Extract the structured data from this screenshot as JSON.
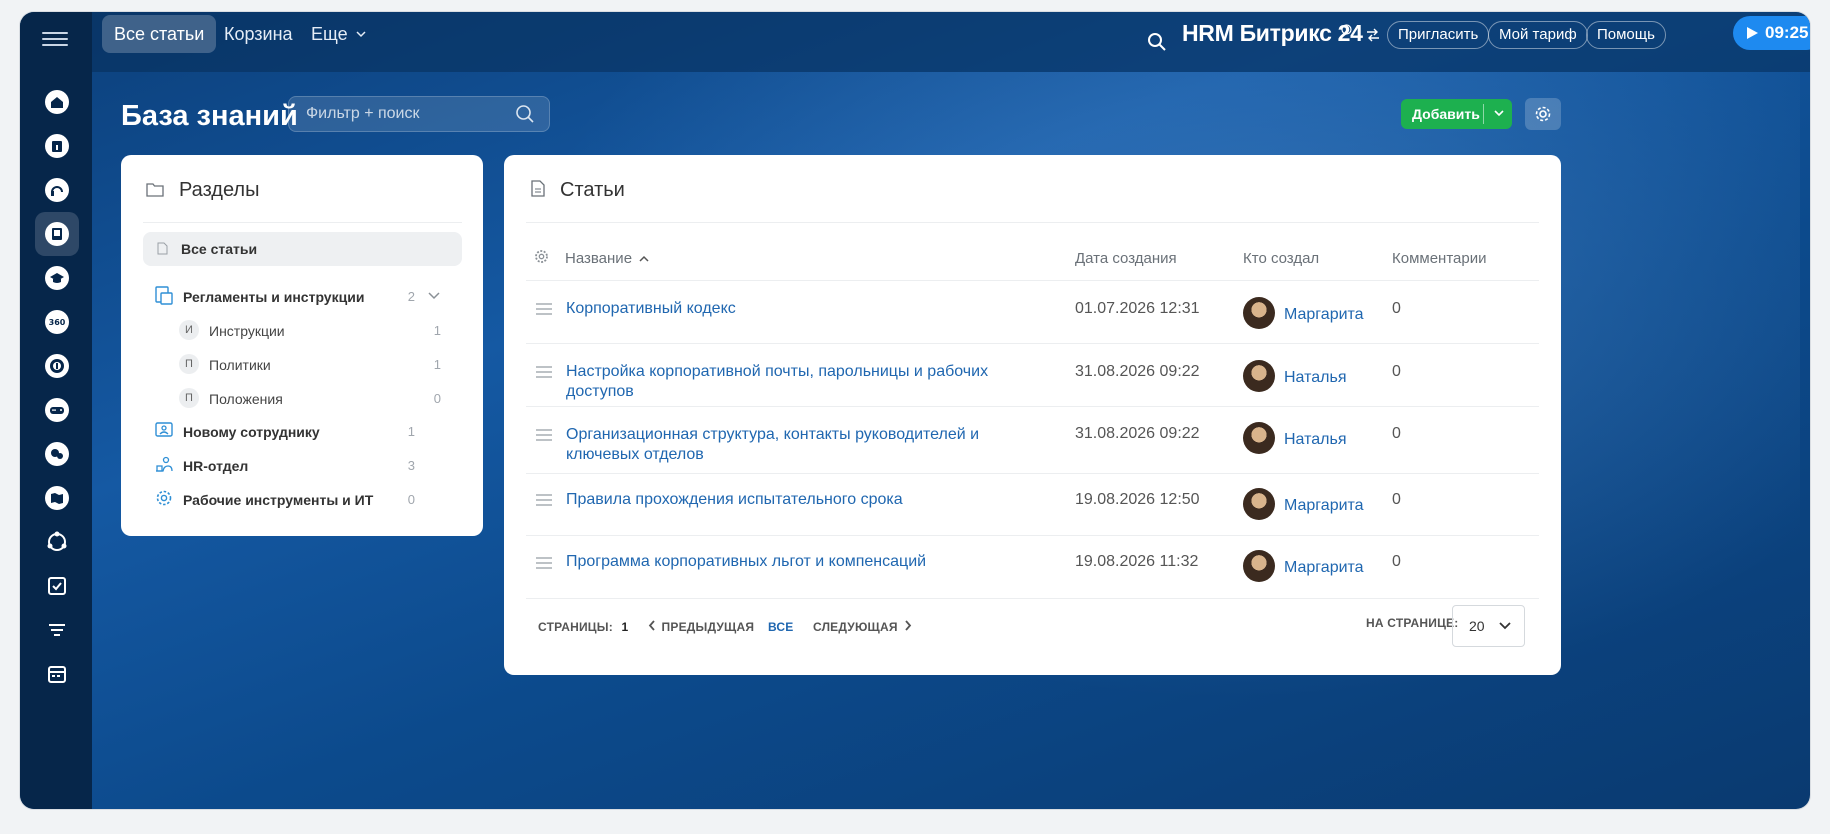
{
  "topbar": {
    "tabs": [
      {
        "label": "Все статьи",
        "active": true
      },
      {
        "label": "Корзина",
        "active": false
      },
      {
        "label": "Еще",
        "active": false
      }
    ],
    "brand": "HRM Битрикс 24",
    "invite_label": "Пригласить",
    "tariff_label": "Мой тариф",
    "help_label": "Помощь",
    "timer": "09:25"
  },
  "page": {
    "title": "База знаний",
    "filter_placeholder": "Фильтр + поиск",
    "add_label": "Добавить"
  },
  "sections": {
    "header": "Разделы",
    "all_articles": "Все статьи",
    "items": [
      {
        "label": "Регламенты и инструкции",
        "count": "2",
        "expanded": true,
        "children": [
          {
            "badge": "И",
            "label": "Инструкции",
            "count": "1"
          },
          {
            "badge": "П",
            "label": "Политики",
            "count": "1"
          },
          {
            "badge": "П",
            "label": "Положения",
            "count": "0"
          }
        ]
      },
      {
        "label": "Новому сотруднику",
        "count": "1"
      },
      {
        "label": "HR-отдел",
        "count": "3"
      },
      {
        "label": "Рабочие инструменты и ИТ",
        "count": "0"
      }
    ]
  },
  "articles": {
    "header": "Статьи",
    "columns": {
      "name": "Название",
      "created": "Дата создания",
      "author": "Кто создал",
      "comments": "Комментарии"
    },
    "rows": [
      {
        "title": "Корпоративный кодекс",
        "date": "01.07.2026 12:31",
        "author": "Маргарита",
        "comments": "0"
      },
      {
        "title": "Настройка корпоративной почты, парольницы и рабочих доступов",
        "date": "31.08.2026 09:22",
        "author": "Наталья",
        "comments": "0"
      },
      {
        "title": "Организационная структура, контакты руководителей и ключевых отделов",
        "date": "31.08.2026 09:22",
        "author": "Наталья",
        "comments": "0"
      },
      {
        "title": "Правила прохождения испытательного срока",
        "date": "19.08.2026 12:50",
        "author": "Маргарита",
        "comments": "0"
      },
      {
        "title": "Программа корпоративных льгот и компенсаций",
        "date": "19.08.2026 11:32",
        "author": "Маргарита",
        "comments": "0"
      }
    ],
    "pager": {
      "pages_label": "СТРАНИЦЫ:",
      "current_page": "1",
      "prev_label": "ПРЕДЫДУЩАЯ",
      "all_label": "ВСЕ",
      "next_label": "СЛЕДУЮЩАЯ",
      "per_page_label": "НА СТРАНИЦЕ:",
      "per_page_value": "20"
    }
  },
  "colors": {
    "accent": "#2067b0",
    "add_button": "#1db04f",
    "timer": "#1e8af0",
    "rail": "#06264a"
  },
  "rail_icons": [
    "home-icon",
    "info-icon",
    "support-icon",
    "knowledge-base-icon",
    "education-icon",
    "360-icon",
    "target-icon",
    "gamepad-icon",
    "feedback-icon",
    "map-icon",
    "processes-icon",
    "tasks-icon",
    "filter-icon",
    "calendar-icon"
  ]
}
